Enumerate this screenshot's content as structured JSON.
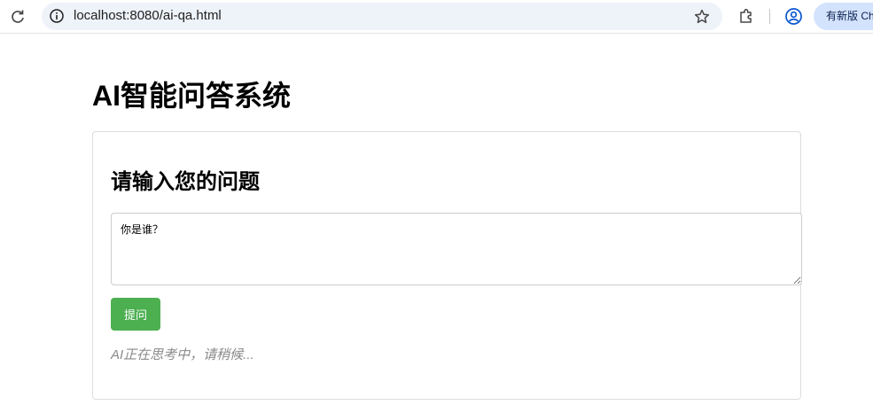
{
  "browser": {
    "url": "localhost:8080/ai-qa.html",
    "update_button_label": "有新版 Chrome"
  },
  "page": {
    "title": "AI智能问答系统",
    "card": {
      "title": "请输入您的问题",
      "input_value": "你是谁？",
      "submit_label": "提问",
      "status_text": "AI正在思考中，请稍候..."
    }
  },
  "colors": {
    "submit_button": "#4caf50",
    "omnibox_bg": "#eef2f9",
    "update_button_bg": "#d3e3fd",
    "status_text": "#8a8a8a"
  },
  "icons": [
    "reload-icon",
    "site-info-icon",
    "bookmark-star-icon",
    "extensions-icon",
    "profile-icon"
  ]
}
